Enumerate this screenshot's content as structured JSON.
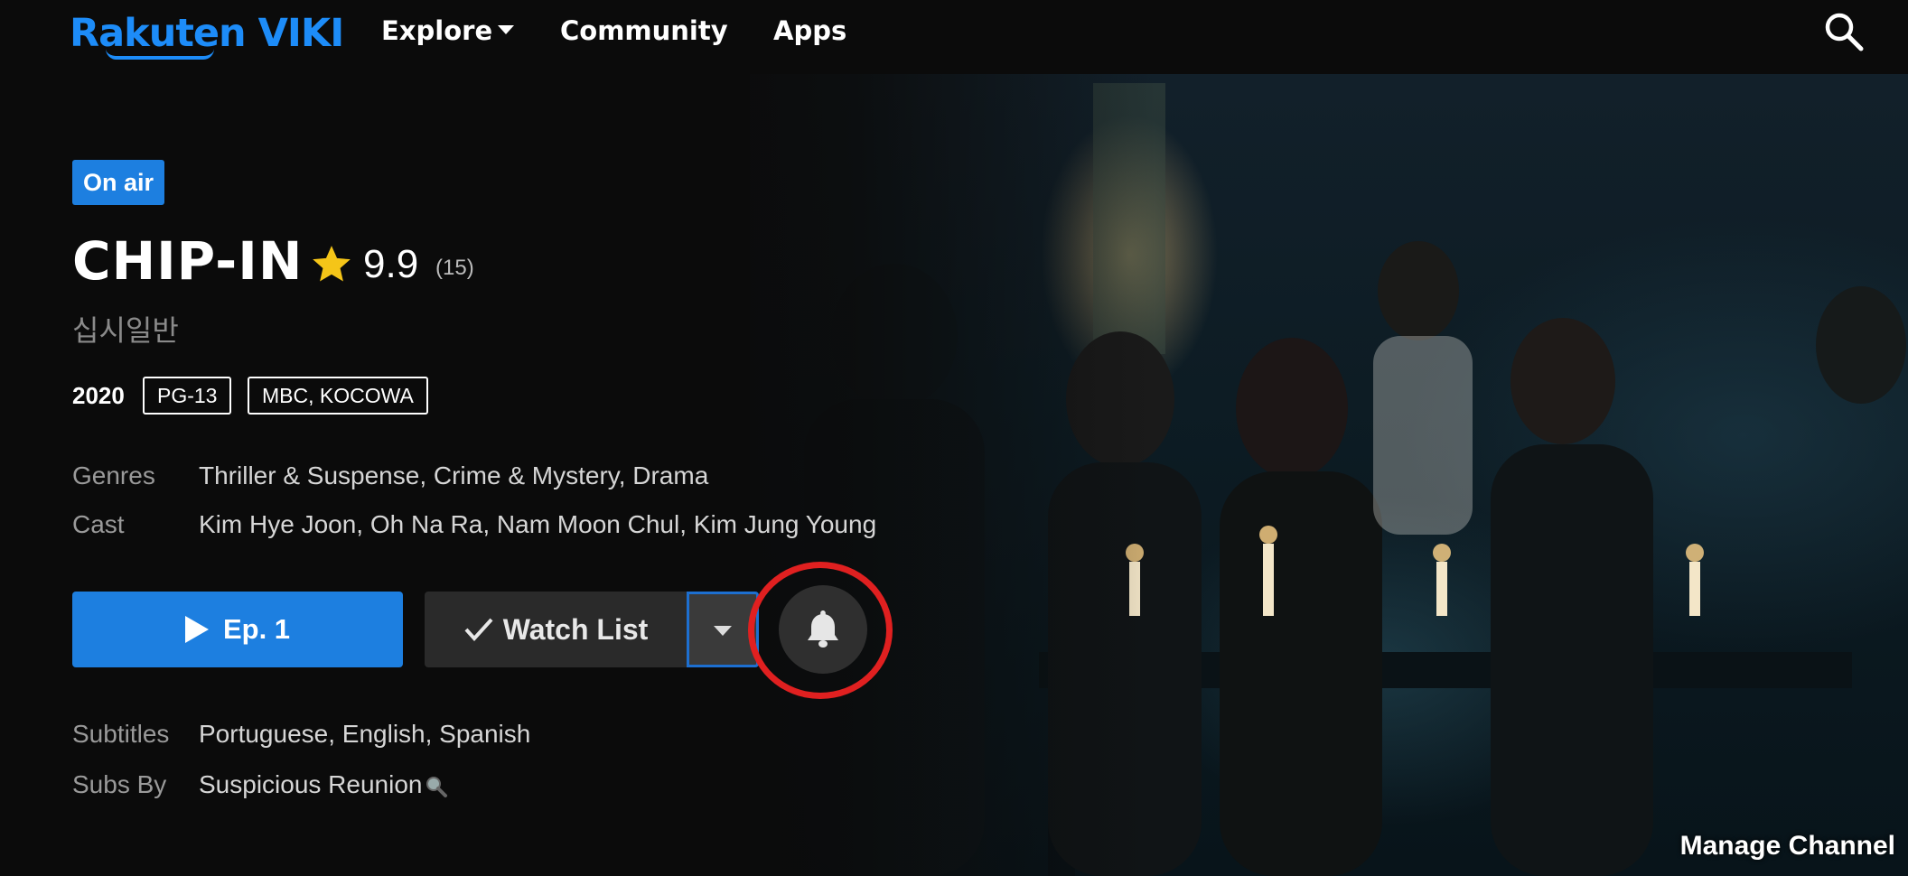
{
  "header": {
    "logo_text": "Rakuten VIKI",
    "nav": {
      "explore": "Explore",
      "community": "Community",
      "apps": "Apps"
    },
    "search_icon": "search-icon"
  },
  "show": {
    "status_badge": "On air",
    "title": "CHIP-IN",
    "rating_score": "9.9",
    "rating_count": "(15)",
    "alt_title": "십시일반",
    "year": "2020",
    "content_rating": "PG-13",
    "network": "MBC, KOCOWA",
    "genres_label": "Genres",
    "genres": "Thriller & Suspense, Crime & Mystery, Drama",
    "cast_label": "Cast",
    "cast": "Kim Hye Joon, Oh Na Ra, Nam Moon Chul, Kim Jung Young"
  },
  "actions": {
    "play_label": "Ep. 1",
    "watchlist_label": "Watch List",
    "dropdown_icon": "chevron-down-icon",
    "notify_icon": "bell-icon"
  },
  "subtitles": {
    "label": "Subtitles",
    "value": "Portuguese, English, Spanish",
    "subs_by_label": "Subs By",
    "subs_by_value": "Suspicious Reunion"
  },
  "footer": {
    "manage_channel": "Manage Channel"
  },
  "colors": {
    "accent": "#1d7fe0",
    "logo": "#1d8cf8",
    "highlight": "#e02020",
    "star": "#f5c518"
  }
}
